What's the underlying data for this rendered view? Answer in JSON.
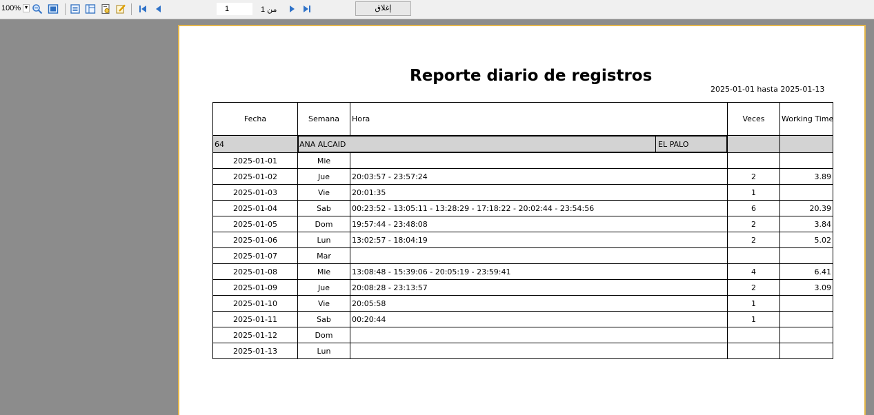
{
  "toolbar": {
    "zoom": "100%",
    "page_current": "1",
    "page_of": "من 1",
    "close_label": "إغلاق"
  },
  "report": {
    "title": "Reporte diario de registros",
    "range": "2025-01-01 hasta 2025-01-13",
    "headers": {
      "fecha": "Fecha",
      "semana": "Semana",
      "hora": "Hora",
      "veces": "Veces",
      "wt": "Working Time"
    },
    "group": {
      "id": "64",
      "name": "ANA ALCAID",
      "place": "EL PALO"
    },
    "rows": [
      {
        "fecha": "2025-01-01",
        "semana": "Mie",
        "hora": "",
        "veces": "",
        "wt": ""
      },
      {
        "fecha": "2025-01-02",
        "semana": "Jue",
        "hora": "20:03:57 - 23:57:24",
        "veces": "2",
        "wt": "3.89"
      },
      {
        "fecha": "2025-01-03",
        "semana": "Vie",
        "hora": "20:01:35",
        "veces": "1",
        "wt": ""
      },
      {
        "fecha": "2025-01-04",
        "semana": "Sab",
        "hora": "00:23:52 - 13:05:11 - 13:28:29 - 17:18:22 - 20:02:44 - 23:54:56",
        "veces": "6",
        "wt": "20.39"
      },
      {
        "fecha": "2025-01-05",
        "semana": "Dom",
        "hora": "19:57:44 - 23:48:08",
        "veces": "2",
        "wt": "3.84"
      },
      {
        "fecha": "2025-01-06",
        "semana": "Lun",
        "hora": "13:02:57 - 18:04:19",
        "veces": "2",
        "wt": "5.02"
      },
      {
        "fecha": "2025-01-07",
        "semana": "Mar",
        "hora": "",
        "veces": "",
        "wt": ""
      },
      {
        "fecha": "2025-01-08",
        "semana": "Mie",
        "hora": "13:08:48 - 15:39:06 - 20:05:19 - 23:59:41",
        "veces": "4",
        "wt": "6.41"
      },
      {
        "fecha": "2025-01-09",
        "semana": "Jue",
        "hora": "20:08:28 - 23:13:57",
        "veces": "2",
        "wt": "3.09"
      },
      {
        "fecha": "2025-01-10",
        "semana": "Vie",
        "hora": "20:05:58",
        "veces": "1",
        "wt": ""
      },
      {
        "fecha": "2025-01-11",
        "semana": "Sab",
        "hora": "00:20:44",
        "veces": "1",
        "wt": ""
      },
      {
        "fecha": "2025-01-12",
        "semana": "Dom",
        "hora": "",
        "veces": "",
        "wt": ""
      },
      {
        "fecha": "2025-01-13",
        "semana": "Lun",
        "hora": "",
        "veces": "",
        "wt": ""
      }
    ]
  }
}
